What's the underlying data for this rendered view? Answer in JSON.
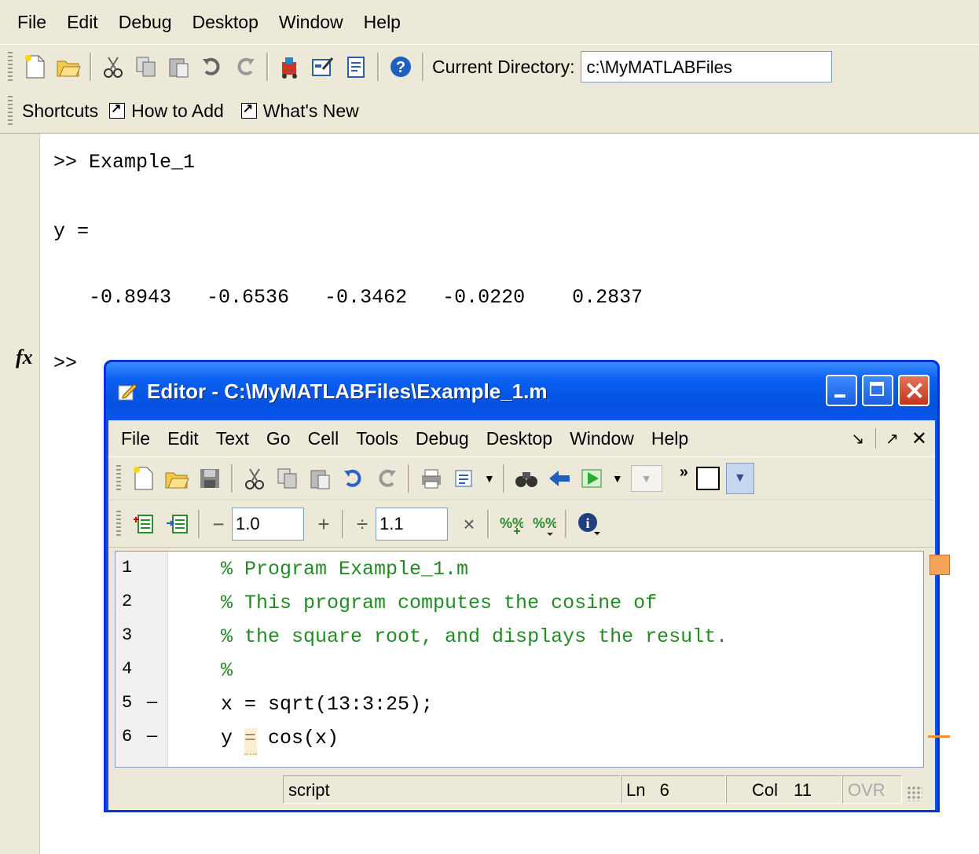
{
  "main": {
    "menu": [
      "File",
      "Edit",
      "Debug",
      "Desktop",
      "Window",
      "Help"
    ],
    "current_directory_label": "Current Directory:",
    "current_directory_value": "c:\\MyMATLABFiles",
    "shortcuts_label": "Shortcuts",
    "shortcut_items": [
      "How to Add",
      "What's New"
    ],
    "command_window": {
      "line1": ">> Example_1",
      "line2": "y =",
      "line3": "   -0.8943   -0.6536   -0.3462   -0.0220    0.2837",
      "prompt": ">>",
      "fx": "fx"
    }
  },
  "editor": {
    "title": "Editor - C:\\MyMATLABFiles\\Example_1.m",
    "menu": [
      "File",
      "Edit",
      "Text",
      "Go",
      "Cell",
      "Tools",
      "Debug",
      "Desktop",
      "Window",
      "Help"
    ],
    "cell_minus": "−",
    "cell_plus": "+",
    "cell_divide": "÷",
    "cell_times": "×",
    "increment_value": "1.0",
    "multiply_value": "1.1",
    "lines": [
      {
        "num": "1",
        "dash": "",
        "code": "% Program Example_1.m",
        "comment": true
      },
      {
        "num": "2",
        "dash": "",
        "code": "% This program computes the cosine of",
        "comment": true
      },
      {
        "num": "3",
        "dash": "",
        "code": "% the square root, and displays the result.",
        "comment": true
      },
      {
        "num": "4",
        "dash": "",
        "code": "%",
        "comment": true
      },
      {
        "num": "5",
        "dash": "—",
        "code": "x = sqrt(13:3:25);",
        "comment": false
      },
      {
        "num": "6",
        "dash": "—",
        "code": "y = cos(x)",
        "comment": false
      }
    ],
    "status": {
      "mode": "script",
      "ln_label": "Ln",
      "ln_value": "6",
      "col_label": "Col",
      "col_value": "11",
      "ovr": "OVR"
    }
  }
}
